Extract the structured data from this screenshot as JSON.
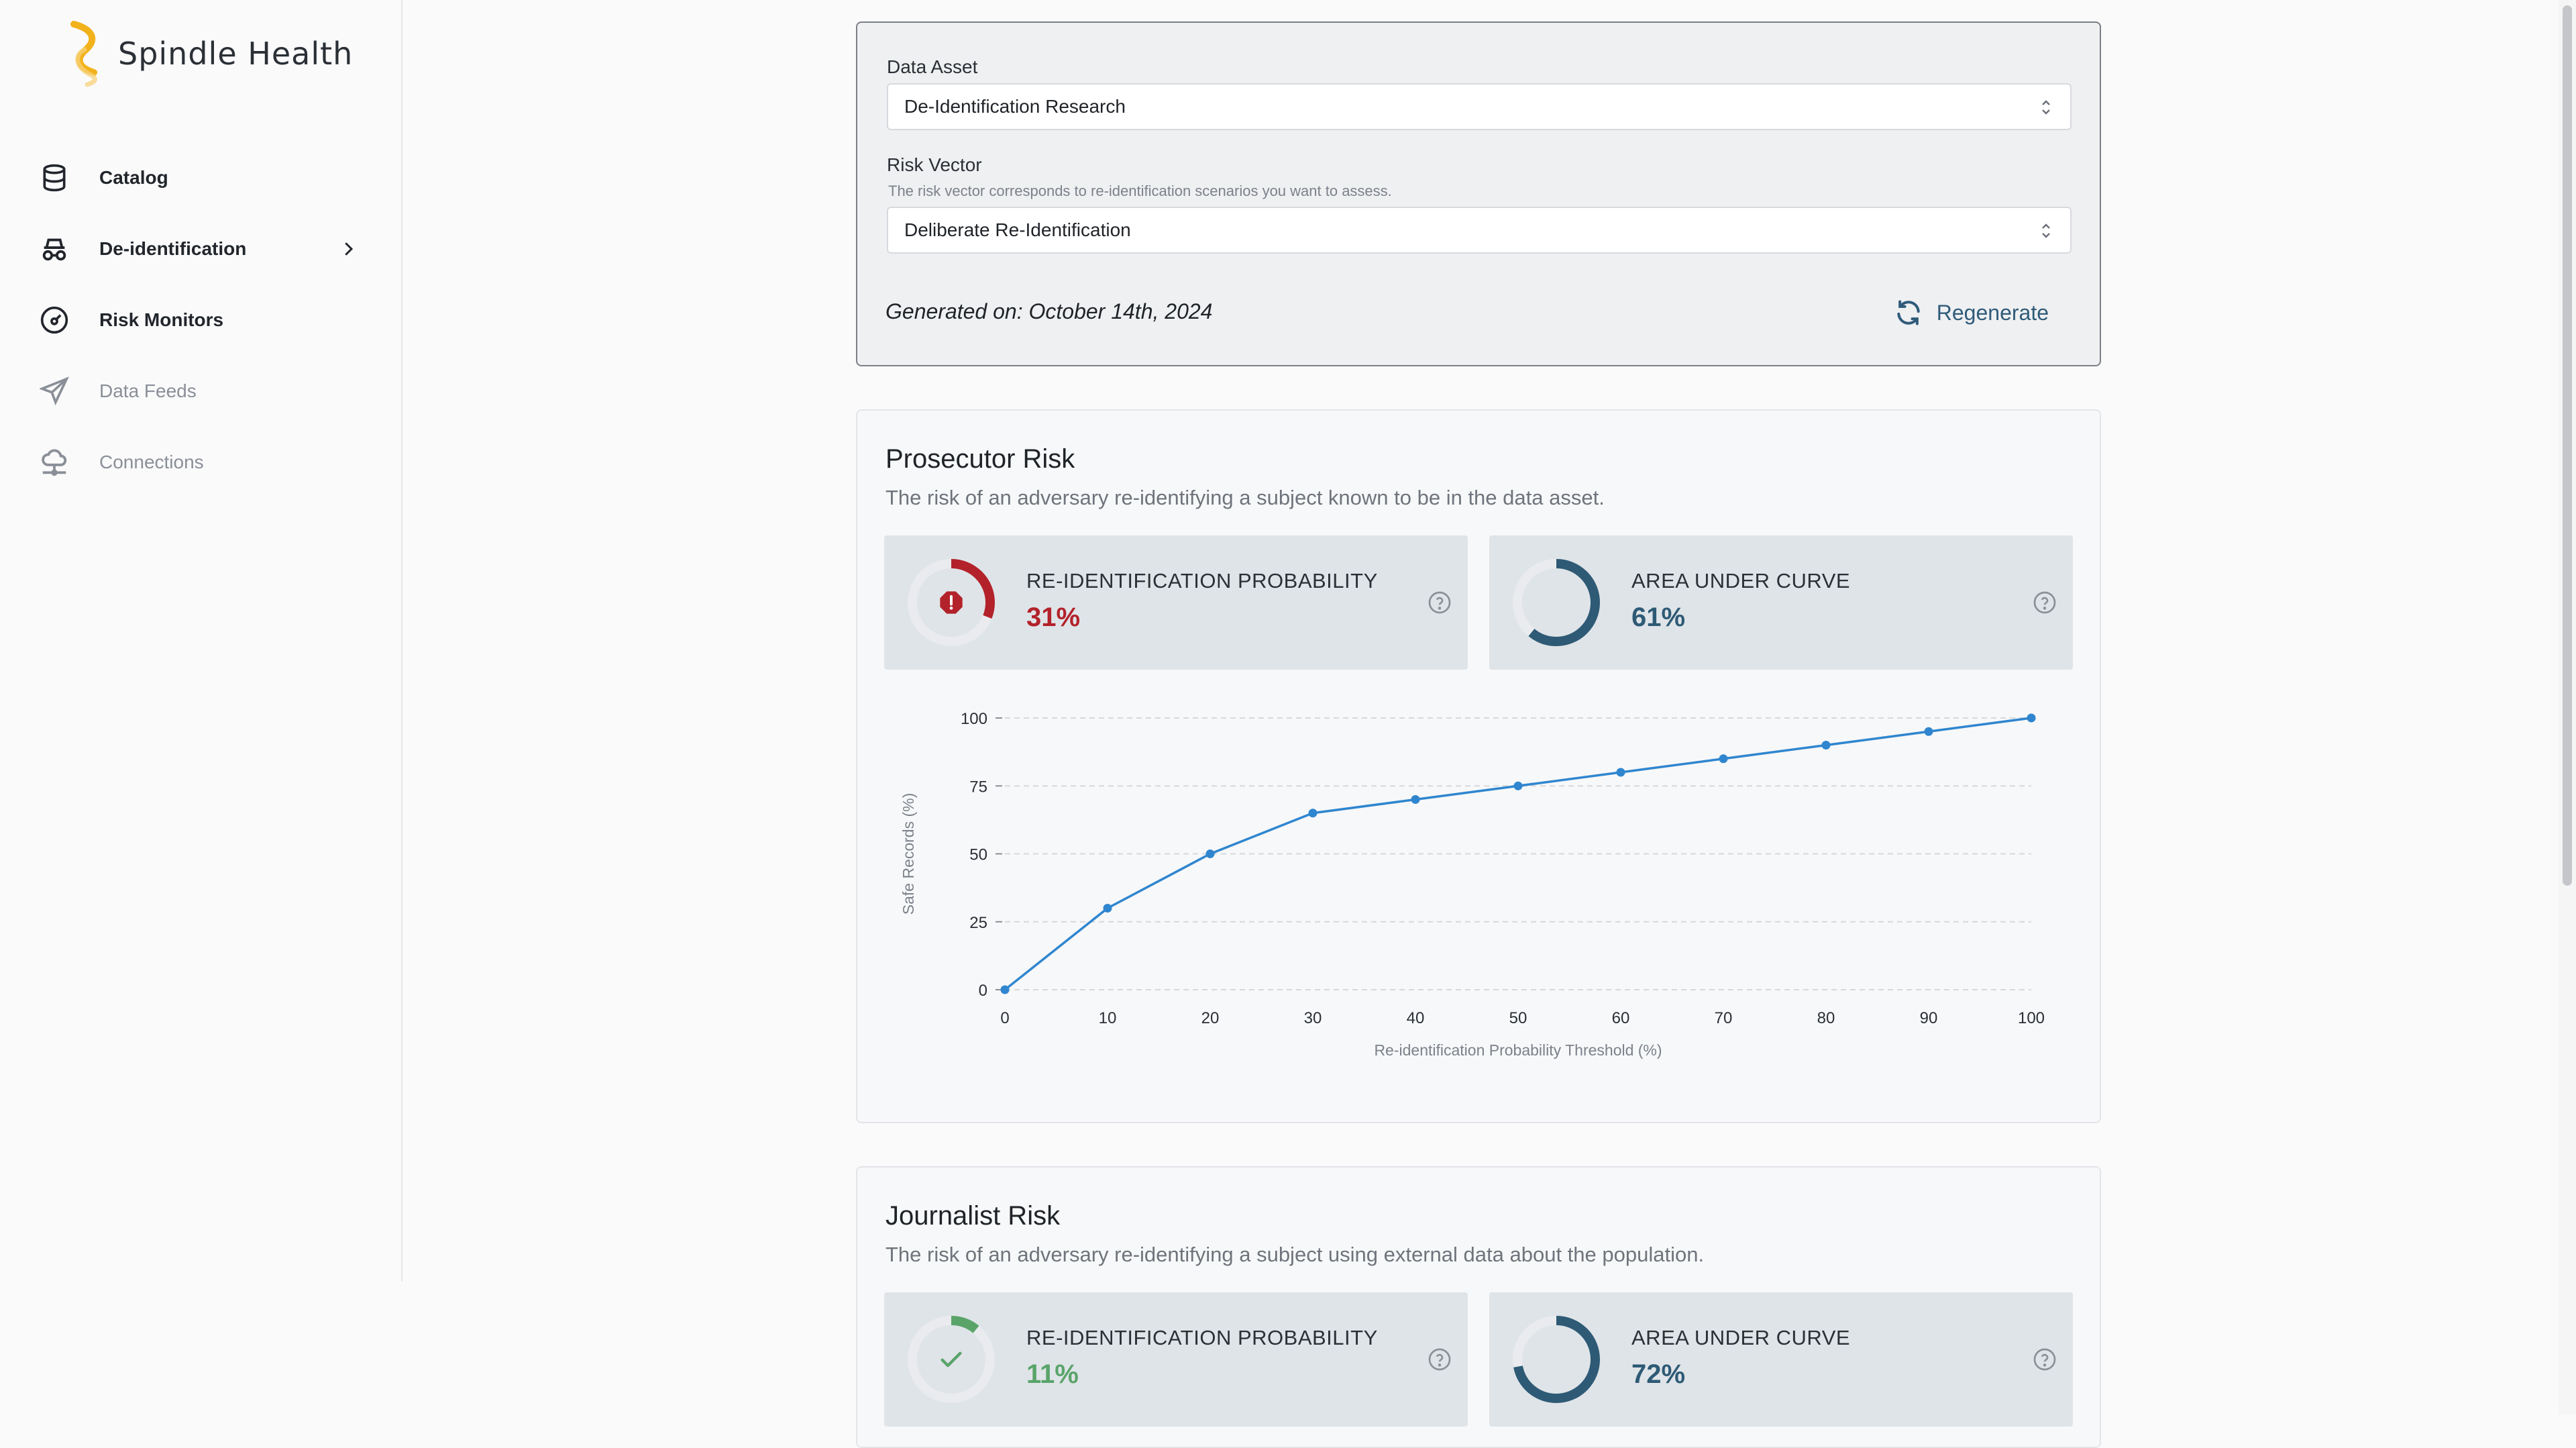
{
  "app": {
    "name": "Spindle Health"
  },
  "sidebar": {
    "items": [
      {
        "label": "Catalog",
        "icon": "database-icon",
        "enabled": true
      },
      {
        "label": "De-identification",
        "icon": "incognito-icon",
        "enabled": true,
        "has_submenu": true
      },
      {
        "label": "Risk Monitors",
        "icon": "gauge-icon",
        "enabled": true
      },
      {
        "label": "Data Feeds",
        "icon": "send-icon",
        "enabled": false
      },
      {
        "label": "Connections",
        "icon": "cloud-network-icon",
        "enabled": false
      }
    ]
  },
  "config": {
    "data_asset_label": "Data Asset",
    "data_asset_value": "De-Identification Research",
    "risk_vector_label": "Risk Vector",
    "risk_vector_help": "The risk vector corresponds to re-identification scenarios you want to assess.",
    "risk_vector_value": "Deliberate Re-Identification",
    "generated_on": "Generated on: October 14th, 2024",
    "regenerate_label": "Regenerate"
  },
  "prosecutor": {
    "title": "Prosecutor Risk",
    "description": "The risk of an adversary re-identifying a subject known to be in the data asset.",
    "reid_label": "RE-IDENTIFICATION PROBABILITY",
    "reid_value": "31%",
    "reid_fraction": 0.31,
    "reid_status": "alert",
    "auc_label": "AREA UNDER CURVE",
    "auc_value": "61%",
    "auc_fraction": 0.61
  },
  "journalist": {
    "title": "Journalist Risk",
    "description": "The risk of an adversary re-identifying a subject using external data about the population.",
    "reid_label": "RE-IDENTIFICATION PROBABILITY",
    "reid_value": "11%",
    "reid_fraction": 0.11,
    "reid_status": "ok",
    "auc_label": "AREA UNDER CURVE",
    "auc_value": "72%",
    "auc_fraction": 0.72
  },
  "colors": {
    "alert": "#b3222a",
    "ok": "#5aa46a",
    "auc": "#2e5a75",
    "ring_track": "#e9ebee",
    "line": "#2f86cf",
    "accent": "#2f5b7a"
  },
  "chart_data": {
    "type": "line",
    "title": "",
    "xlabel": "Re-identification Probability Threshold (%)",
    "ylabel": "Safe Records (%)",
    "x": [
      0,
      10,
      20,
      30,
      40,
      50,
      60,
      70,
      80,
      90,
      100
    ],
    "series": [
      {
        "values": [
          0,
          30,
          50,
          65,
          70,
          75,
          80,
          85,
          90,
          95,
          100
        ]
      }
    ],
    "xticks": [
      0,
      10,
      20,
      30,
      40,
      50,
      60,
      70,
      80,
      90,
      100
    ],
    "yticks": [
      0,
      25,
      50,
      75,
      100
    ],
    "xlim": [
      0,
      100
    ],
    "ylim": [
      0,
      100
    ],
    "grid": "horizontal-dashed"
  }
}
